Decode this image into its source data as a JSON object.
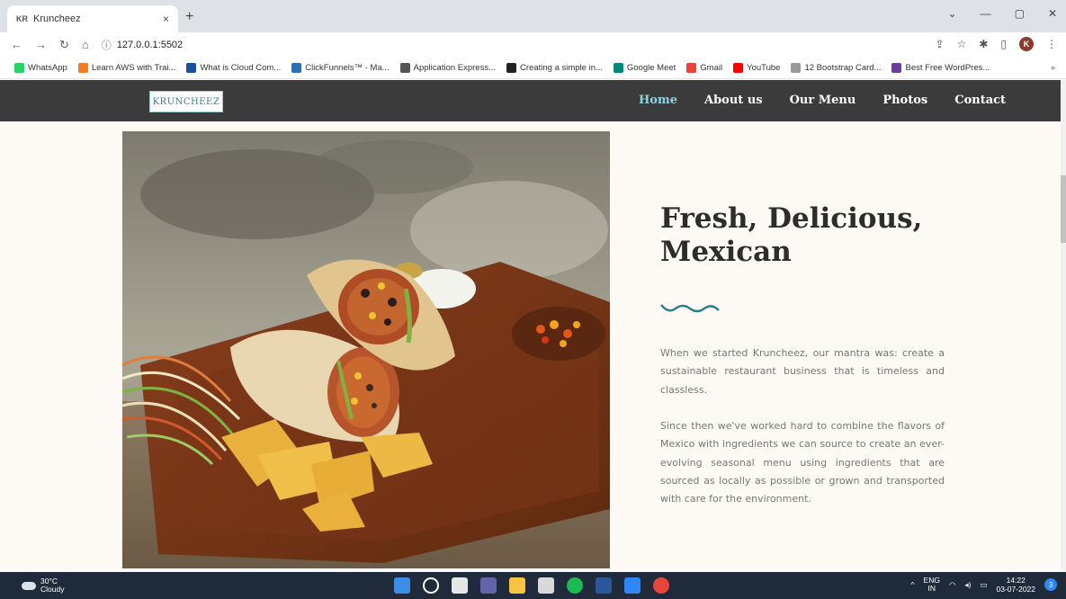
{
  "browser": {
    "tab_favicon": "KR",
    "tab_title": "Kruncheez",
    "tab_close": "×",
    "new_tab": "+",
    "url": "127.0.0.1:5502",
    "avatar_letter": "K"
  },
  "bookmarks": [
    {
      "label": "WhatsApp",
      "color": "#25d366"
    },
    {
      "label": "Learn AWS with Trai...",
      "color": "#f47b20"
    },
    {
      "label": "What is Cloud Com...",
      "color": "#1b4fa0"
    },
    {
      "label": "ClickFunnels™ - Ma...",
      "color": "#2a6fb5"
    },
    {
      "label": "Application Express...",
      "color": "#555555"
    },
    {
      "label": "Creating a simple in...",
      "color": "#222222"
    },
    {
      "label": "Google Meet",
      "color": "#00897b"
    },
    {
      "label": "Gmail",
      "color": "#ea4335"
    },
    {
      "label": "YouTube",
      "color": "#ff0000"
    },
    {
      "label": "12 Bootstrap Card...",
      "color": "#999999"
    },
    {
      "label": "Best Free WordPres...",
      "color": "#6a3d9a"
    }
  ],
  "site": {
    "logo": "KRUNCHEEZ",
    "nav": [
      "Home",
      "About us",
      "Our Menu",
      "Photos",
      "Contact"
    ],
    "heading": "Fresh, Delicious, Mexican",
    "para1": "When we started Kruncheez, our mantra was: create a sustainable restaurant business that is timeless and classless.",
    "para2": "Since then we've worked hard to combine the flavors of Mexico with ingredients we can source to create an ever-evolving seasonal menu using ingredients that are sourced as locally as possible or grown and transported with care for the environment.",
    "accent_color": "#2e7f8e"
  },
  "taskbar": {
    "temp": "30°C",
    "weather": "Cloudy",
    "lang1": "ENG",
    "lang2": "IN",
    "time": "14:22",
    "date": "03-07-2022",
    "notifications": "3"
  }
}
